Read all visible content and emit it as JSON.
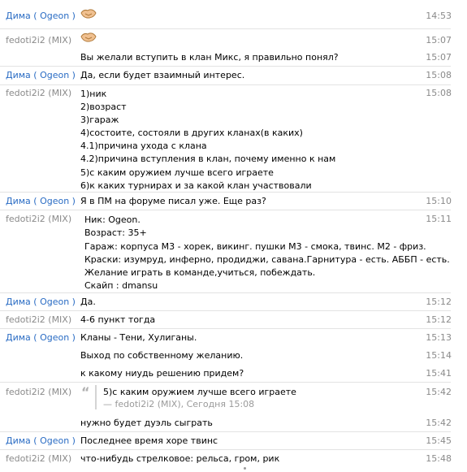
{
  "messages": [
    {
      "author": "Дима ( Ogeon )",
      "time": "14:53",
      "emoji": "handshake-emoji"
    },
    {
      "author": "fedoti2i2 (MIX)",
      "time": "15:07",
      "emoji": "handshake-emoji"
    },
    {
      "author": "",
      "time": "15:07",
      "text": "Вы желали вступить в клан Микс, я правильно понял?"
    },
    {
      "author": "Дима ( Ogeon )",
      "time": "15:08",
      "text": "Да, если будет взаимный интерес."
    },
    {
      "author": "fedoti2i2 (MIX)",
      "time": "15:08",
      "lines": [
        "1)ник",
        "2)возраст",
        "3)гараж",
        "4)состоите, состояли в других кланах(в каких)",
        "4.1)причина ухода с клана",
        "4.2)причина вступления в клан, почему именно к нам",
        "5)с каким оружием лучше всего играете",
        "6)к каких турнирах и за какой клан участвовали"
      ]
    },
    {
      "author": "Дима ( Ogeon )",
      "time": "15:10",
      "text": "Я в ПМ  на форуме писал уже. Еще раз?"
    },
    {
      "author": "fedoti2i2 (MIX)",
      "time": "15:11",
      "lines": [
        "Ник: Ogeon.",
        "Возраст: 35+",
        "Гараж: корпуса  М3 - хорек, викинг.  пушки М3 - смока, твинс. М2 - фриз.",
        "Краски: изумруд, инферно, продиджи, савана.Гарнитура - есть. АББП - есть.",
        "Желание играть в команде,учиться, побеждать.",
        "Скайп :  dmansu"
      ]
    },
    {
      "author": "Дима ( Ogeon )",
      "time": "15:12",
      "text": "Да."
    },
    {
      "author": "fedoti2i2 (MIX)",
      "time": "15:12",
      "text": "4-6 пункт тогда"
    },
    {
      "author": "Дима ( Ogeon )",
      "time": "15:13",
      "text": "Кланы -   Тени, Хулиганы."
    },
    {
      "author": "",
      "time": "15:14",
      "text": "Выход по собственному желанию."
    },
    {
      "author": "",
      "time": "15:41",
      "text": "к какому ниудь решению придем?"
    },
    {
      "author": "fedoti2i2 (MIX)",
      "time": "15:42",
      "quote_text": "5)с каким оружием лучше всего играете",
      "quote_source": "— fedoti2i2 (MIX), Сегодня 15:08"
    },
    {
      "author": "",
      "time": "15:42",
      "text": "нужно будет дуэль сыграть"
    },
    {
      "author": "Дима ( Ogeon )",
      "time": "15:45",
      "text": "Последнее время хоре твинс"
    },
    {
      "author": "fedoti2i2 (MIX)",
      "time": "15:48",
      "text": "что-нибудь стрелковое: рельса, гром, рик"
    }
  ],
  "colors": {
    "dima": "#2a6cc4",
    "fedoti": "#8a8a8a",
    "time": "#8a8a8a",
    "separator": "#e3e3e3"
  }
}
